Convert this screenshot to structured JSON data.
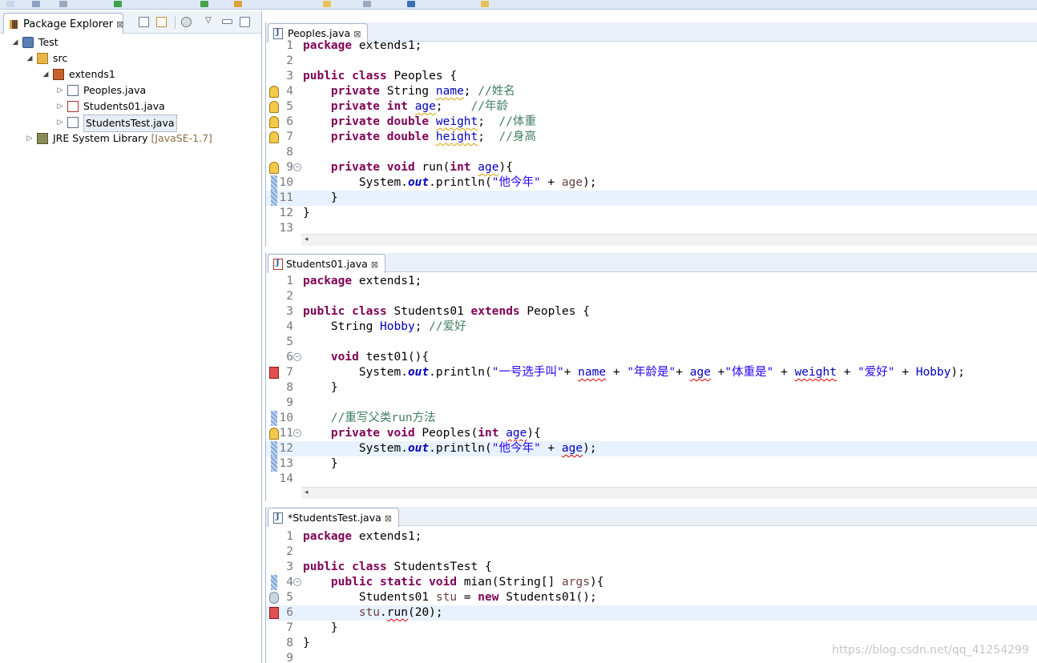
{
  "explorer": {
    "tab_label": "Package Explorer",
    "close": "⊠",
    "tree": [
      {
        "label": "Test",
        "depth": 0,
        "expanded": true,
        "icon": "project-icon"
      },
      {
        "label": "src",
        "depth": 1,
        "expanded": true,
        "icon": "source-folder-icon"
      },
      {
        "label": "extends1",
        "depth": 2,
        "expanded": true,
        "icon": "package-icon"
      },
      {
        "label": "Peoples.java",
        "depth": 3,
        "expanded": false,
        "icon": "java-file-icon"
      },
      {
        "label": "Students01.java",
        "depth": 3,
        "expanded": false,
        "icon": "java-file-error-icon"
      },
      {
        "label": "StudentsTest.java",
        "depth": 3,
        "expanded": false,
        "icon": "java-file-icon",
        "selected": true
      },
      {
        "label": "JRE System Library",
        "suffix": "[JavaSE-1.7]",
        "depth": 1,
        "expanded": false,
        "icon": "library-icon"
      }
    ]
  },
  "editors": [
    {
      "tab": "Peoples.java",
      "lines": [
        {
          "n": "1",
          "code": "package extends1;"
        },
        {
          "n": "2",
          "code": ""
        },
        {
          "n": "3",
          "code": "public class Peoples {"
        },
        {
          "n": "4",
          "code": "    private String name; //姓名",
          "marker": "warn"
        },
        {
          "n": "5",
          "code": "    private int age;    //年龄",
          "marker": "warn"
        },
        {
          "n": "6",
          "code": "    private double weight;  //体重",
          "marker": "warn"
        },
        {
          "n": "7",
          "code": "    private double height;  //身高",
          "marker": "warn"
        },
        {
          "n": "8",
          "code": ""
        },
        {
          "n": "9",
          "code": "    private void run(int age){",
          "marker": "warn",
          "fold": true
        },
        {
          "n": "10",
          "code": "        System.out.println(\"他今年\" + age);",
          "marker": "change"
        },
        {
          "n": "11",
          "code": "    }",
          "marker": "change",
          "highlight": true
        },
        {
          "n": "12",
          "code": "}"
        },
        {
          "n": "13",
          "code": ""
        }
      ]
    },
    {
      "tab": "Students01.java",
      "lines": [
        {
          "n": "1",
          "code": "package extends1;"
        },
        {
          "n": "2",
          "code": ""
        },
        {
          "n": "3",
          "code": "public class Students01 extends Peoples {"
        },
        {
          "n": "4",
          "code": "    String Hobby; //爱好"
        },
        {
          "n": "5",
          "code": ""
        },
        {
          "n": "6",
          "code": "    void test01(){",
          "fold": true
        },
        {
          "n": "7",
          "code": "        System.out.println(\"一号选手叫\"+ name + \"年龄是\"+ age +\"体重是\" + weight + \"爱好\" + Hobby);",
          "marker": "err"
        },
        {
          "n": "8",
          "code": "    }"
        },
        {
          "n": "9",
          "code": ""
        },
        {
          "n": "10",
          "code": "    //重写父类run方法",
          "marker": "change"
        },
        {
          "n": "11",
          "code": "    private void Peoples(int age){",
          "marker": "warn",
          "fold": true
        },
        {
          "n": "12",
          "code": "        System.out.println(\"他今年\" + age);",
          "marker": "change",
          "highlight": true
        },
        {
          "n": "13",
          "code": "    }",
          "marker": "change"
        },
        {
          "n": "14",
          "code": ""
        }
      ]
    },
    {
      "tab": "*StudentsTest.java",
      "lines": [
        {
          "n": "1",
          "code": "package extends1;"
        },
        {
          "n": "2",
          "code": ""
        },
        {
          "n": "3",
          "code": "public class StudentsTest {"
        },
        {
          "n": "4",
          "code": "    public static void mian(String[] args){",
          "marker": "change",
          "fold": true
        },
        {
          "n": "5",
          "code": "        Students01 stu = new Students01();",
          "marker": "info"
        },
        {
          "n": "6",
          "code": "        stu.run(20);",
          "marker": "err",
          "highlight": true
        },
        {
          "n": "7",
          "code": "    }"
        },
        {
          "n": "8",
          "code": "}"
        },
        {
          "n": "9",
          "code": ""
        }
      ]
    }
  ],
  "watermark": "https://blog.csdn.net/qq_41254299"
}
